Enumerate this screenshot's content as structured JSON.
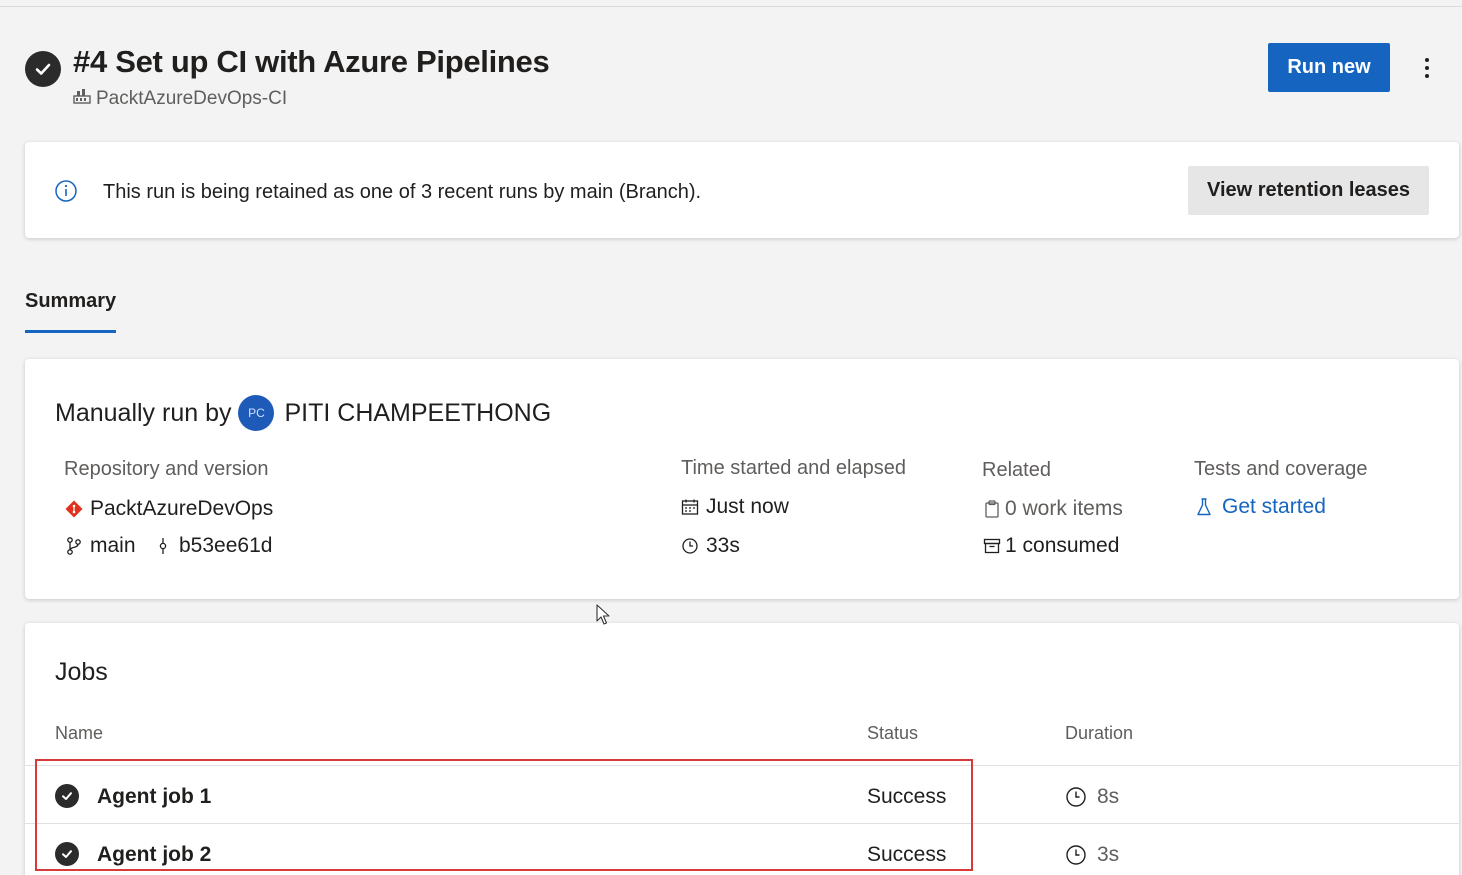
{
  "header": {
    "title": "#4 Set up CI with Azure Pipelines",
    "pipeline_name": "PacktAzureDevOps-CI",
    "run_new_label": "Run new",
    "more_label": "⋮"
  },
  "banner": {
    "text": "This run is being retained as one of 3 recent runs by main (Branch).",
    "button_label": "View retention leases"
  },
  "tabs": [
    {
      "label": "Summary",
      "selected": true
    }
  ],
  "summary": {
    "run_by_prefix": "Manually run by",
    "user_initials": "PC",
    "user_name": "PITI CHAMPEETHONG",
    "repository": {
      "label": "Repository and version",
      "repo_name": "PacktAzureDevOps",
      "branch": "main",
      "commit": "b53ee61d"
    },
    "time": {
      "label": "Time started and elapsed",
      "started": "Just now",
      "elapsed": "33s"
    },
    "related": {
      "label": "Related",
      "work_items": "0 work items",
      "consumed": "1 consumed"
    },
    "tests": {
      "label": "Tests and coverage",
      "link": "Get started"
    }
  },
  "jobs": {
    "title": "Jobs",
    "columns": [
      "Name",
      "Status",
      "Duration"
    ],
    "rows": [
      {
        "name": "Agent job 1",
        "status": "Success",
        "duration": "8s"
      },
      {
        "name": "Agent job 2",
        "status": "Success",
        "duration": "3s"
      }
    ]
  },
  "colors": {
    "accent": "#1565c0",
    "highlight": "#d63a3a",
    "repo_icon": "#e0301e"
  }
}
